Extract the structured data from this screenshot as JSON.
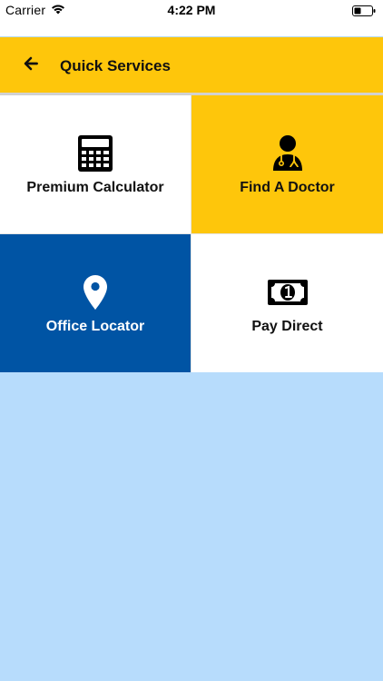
{
  "status_bar": {
    "carrier": "Carrier",
    "time": "4:22 PM",
    "icons": [
      "wifi-icon",
      "battery-icon"
    ]
  },
  "header": {
    "title": "Quick Services",
    "back_icon": "arrow-left-icon",
    "background": "#fec60b"
  },
  "tiles": [
    {
      "label": "Premium Calculator",
      "icon": "calculator-icon",
      "background": "#ffffff",
      "text_color": "#111111"
    },
    {
      "label": "Find A Doctor",
      "icon": "doctor-icon",
      "background": "#fec60b",
      "text_color": "#111111"
    },
    {
      "label": "Office Locator",
      "icon": "map-pin-icon",
      "background": "#0054a4",
      "text_color": "#ffffff"
    },
    {
      "label": "Pay Direct",
      "icon": "money-bill-icon",
      "background": "#ffffff",
      "text_color": "#111111"
    }
  ],
  "colors": {
    "page_background": "#b7dcfc",
    "accent_yellow": "#fec60b",
    "accent_blue": "#0054a4"
  }
}
